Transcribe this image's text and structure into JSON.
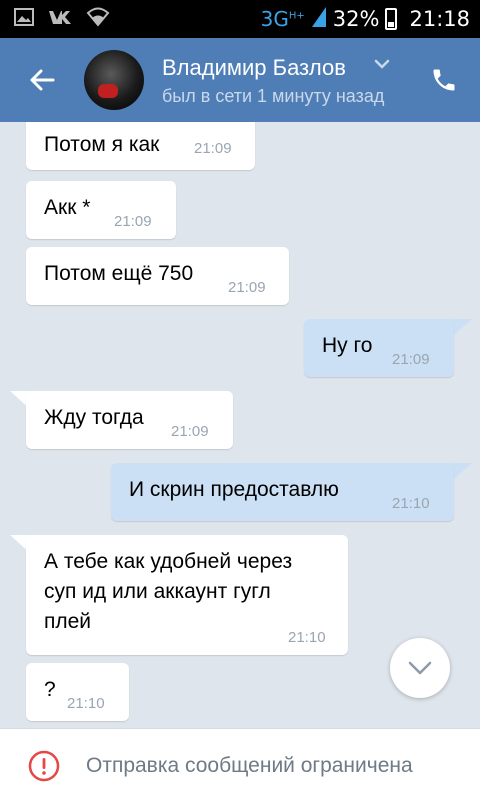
{
  "status_bar": {
    "network": "3G",
    "network_sup": "H+",
    "battery": "32%",
    "time": "21:18",
    "icons": [
      "image-icon",
      "vk-icon",
      "wifi-icon",
      "signal-icon",
      "battery-icon"
    ]
  },
  "header": {
    "contact_name": "Владимир Базлов",
    "last_seen": "был в сети 1 минуту назад",
    "back_icon": "arrow-left-icon",
    "call_icon": "phone-icon"
  },
  "messages": [
    {
      "direction": "in",
      "text": "Потом я как",
      "time": "21:09"
    },
    {
      "direction": "in",
      "text": "Акк *",
      "time": "21:09"
    },
    {
      "direction": "in",
      "text": "Потом ещё 750",
      "time": "21:09"
    },
    {
      "direction": "out",
      "text": "Ну го",
      "time": "21:09"
    },
    {
      "direction": "in",
      "text": "Жду тогда",
      "time": "21:09"
    },
    {
      "direction": "out",
      "text": "И скрин предоставлю",
      "time": "21:10"
    },
    {
      "direction": "in",
      "text": "А тебе как удобней через суп ид или аккаунт гугл плей",
      "lines": [
        "А тебе как удобней через",
        "суп ид или аккаунт гугл",
        "плей"
      ],
      "time": "21:10"
    },
    {
      "direction": "in",
      "text": "?",
      "time": "21:10"
    }
  ],
  "footer": {
    "notice": "Отправка сообщений ограничена"
  },
  "colors": {
    "header_bg": "#4f7eb6",
    "chat_bg": "#dfe5ec",
    "incoming_bubble": "#ffffff",
    "outgoing_bubble": "#cce0f5",
    "warning_red": "#e64646"
  }
}
